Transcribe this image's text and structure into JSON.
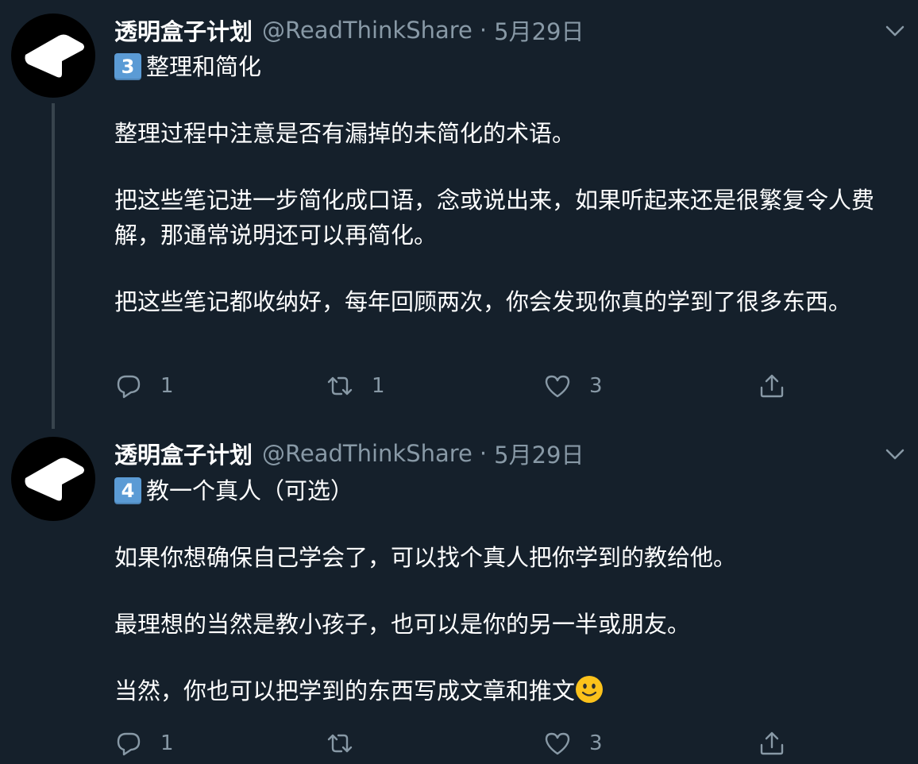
{
  "tweets": [
    {
      "author_name": "透明盒子计划",
      "handle": "@ReadThinkShare",
      "separator": "·",
      "date": "5月29日",
      "title_number": "3",
      "title_text": "整理和简化",
      "paragraphs": [
        "整理过程中注意是否有漏掉的未简化的术语。",
        "把这些笔记进一步简化成口语，念或说出来，如果听起来还是很繁复令人费解，那通常说明还可以再简化。",
        "把这些笔记都收纳好，每年回顾两次，你会发现你真的学到了很多东西。"
      ],
      "reply_count": "1",
      "retweet_count": "1",
      "like_count": "3"
    },
    {
      "author_name": "透明盒子计划",
      "handle": "@ReadThinkShare",
      "separator": "·",
      "date": "5月29日",
      "title_number": "4",
      "title_text": "教一个真人（可选）",
      "paragraphs": [
        "如果你想确保自己学会了，可以找个真人把你学到的教给他。",
        "最理想的当然是教小孩子，也可以是你的另一半或朋友。",
        "当然，你也可以把学到的东西写成文章和推文"
      ],
      "reply_count": "1",
      "retweet_count": "",
      "like_count": "3"
    }
  ],
  "icons": {
    "avatar": "box-logo-icon",
    "menu": "chevron-down-icon",
    "reply": "speech-bubble-icon",
    "retweet": "retweet-icon",
    "like": "heart-icon",
    "share": "share-upload-icon",
    "emoji": "slightly-smiling-face-emoji"
  },
  "colors": {
    "background": "#15202b",
    "secondary_text": "#8899a6",
    "keycap": "#5b9bd5",
    "thread_line": "#38444d"
  }
}
